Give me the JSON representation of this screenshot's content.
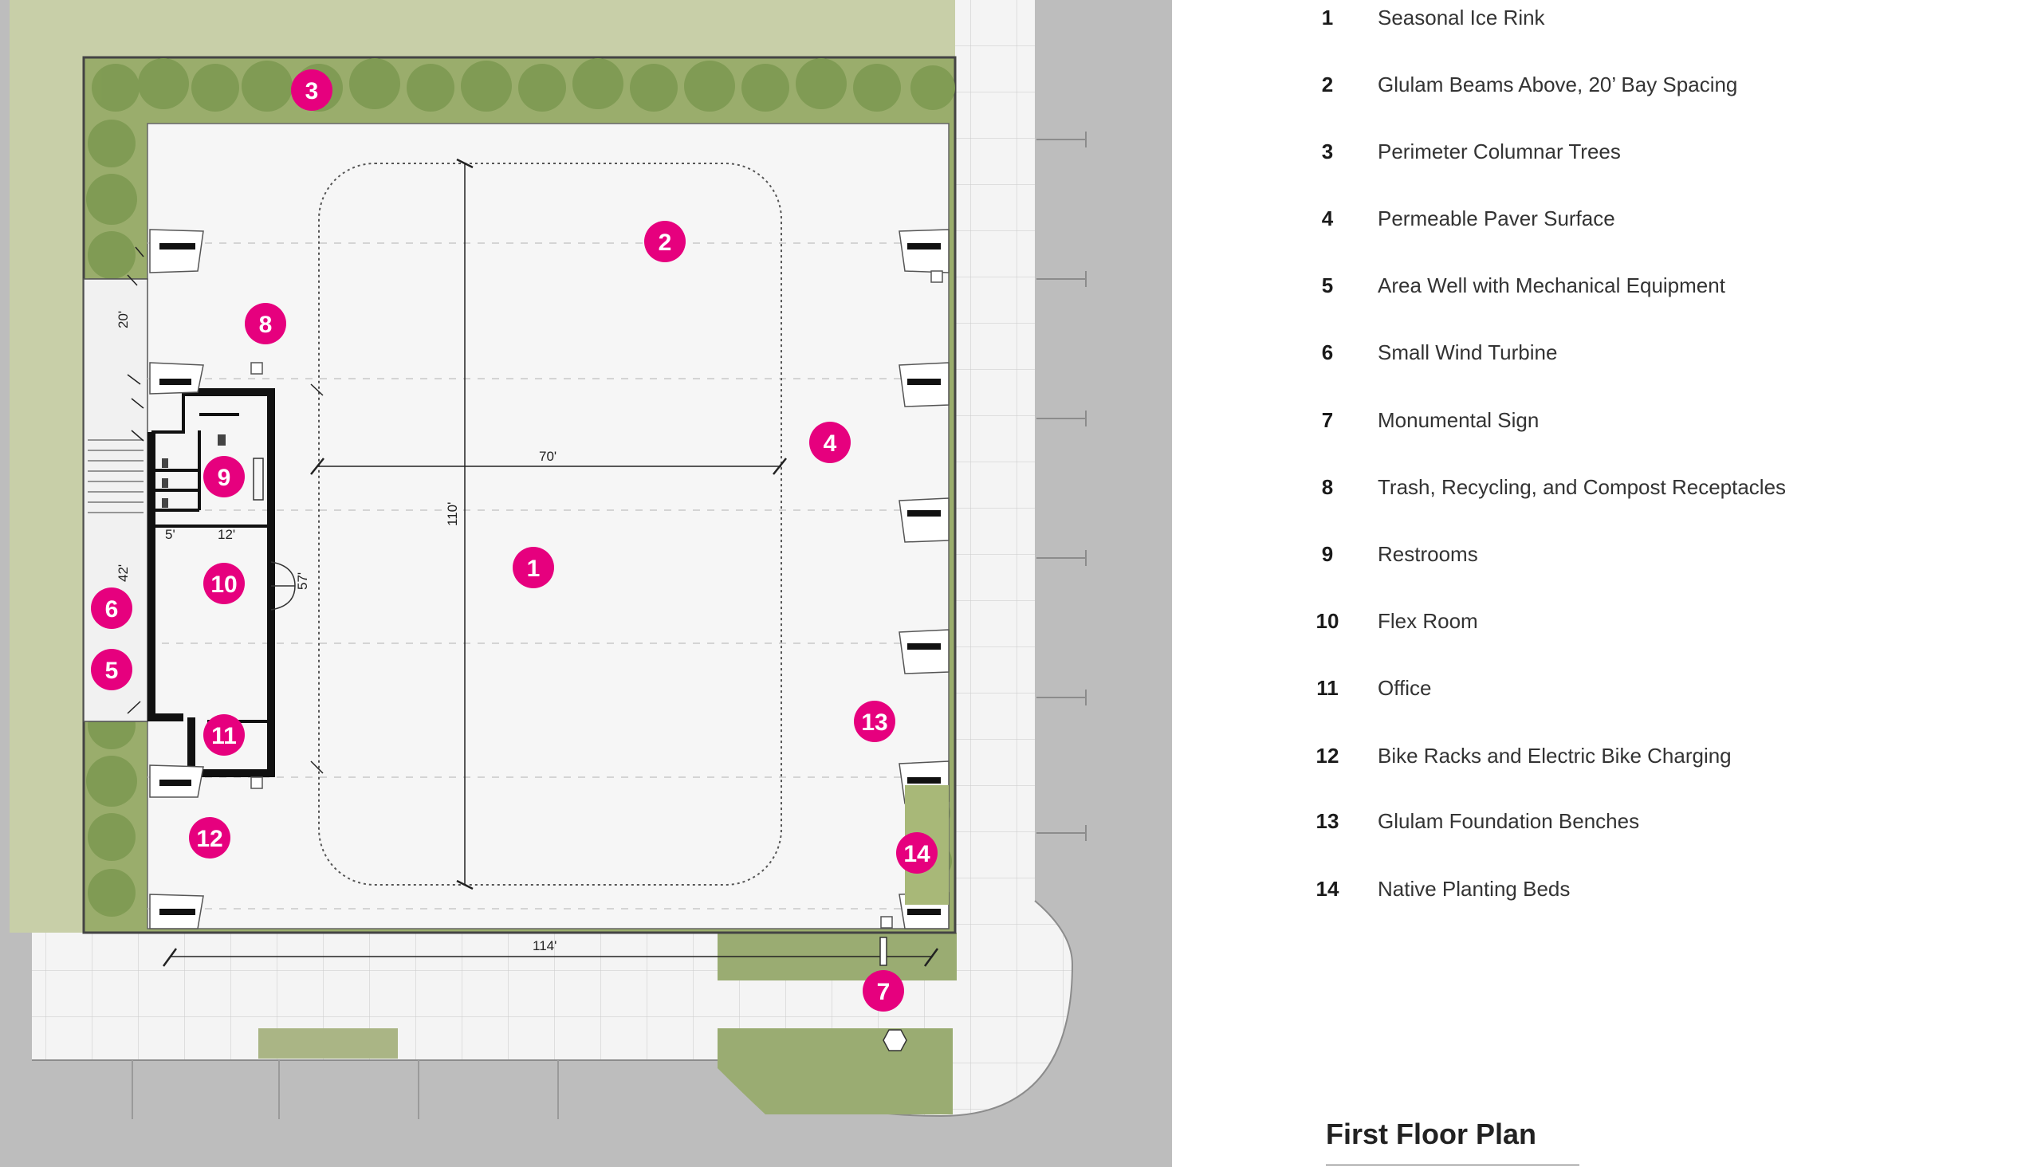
{
  "legend": [
    {
      "num": "1",
      "label": "Seasonal Ice Rink"
    },
    {
      "num": "2",
      "label": "Glulam Beams Above, 20’ Bay Spacing"
    },
    {
      "num": "3",
      "label": "Perimeter Columnar Trees"
    },
    {
      "num": "4",
      "label": "Permeable Paver Surface"
    },
    {
      "num": "5",
      "label": "Area Well with Mechanical Equipment"
    },
    {
      "num": "6",
      "label": "Small Wind Turbine"
    },
    {
      "num": "7",
      "label": "Monumental Sign"
    },
    {
      "num": "8",
      "label": "Trash, Recycling, and Compost Receptacles"
    },
    {
      "num": "9",
      "label": "Restrooms"
    },
    {
      "num": "10",
      "label": "Flex Room"
    },
    {
      "num": "11",
      "label": "Office"
    },
    {
      "num": "12",
      "label": "Bike Racks and Electric Bike Charging"
    },
    {
      "num": "13",
      "label": "Glulam Foundation Benches"
    },
    {
      "num": "14",
      "label": "Native Planting Beds"
    }
  ],
  "dimensions": {
    "bay": "20'",
    "rink_width": "70'",
    "rink_length": "110'",
    "pavilion_length": "42'",
    "restroom_width": "5'",
    "room_width": "12'",
    "room_length": "57'",
    "site_width": "114'"
  },
  "callouts": [
    "1",
    "2",
    "3",
    "4",
    "5",
    "6",
    "7",
    "8",
    "9",
    "10",
    "11",
    "12",
    "13",
    "14"
  ],
  "title": "First Floor Plan",
  "colors": {
    "callout": "#e6007e",
    "street": "#bdbdbd",
    "grass": "#c7cfa6",
    "planting": "#8fa565",
    "paving": "#f5f5f5",
    "wall": "#111111"
  }
}
